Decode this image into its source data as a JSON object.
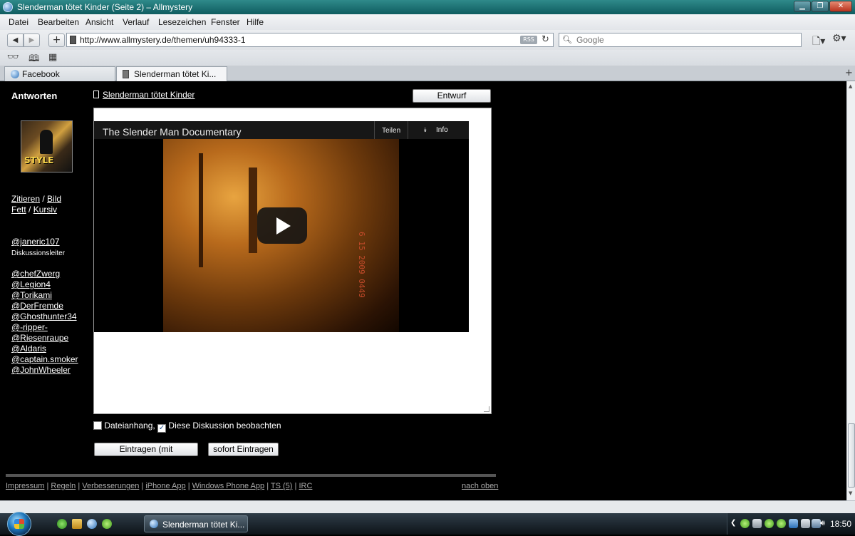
{
  "window": {
    "title": "Slenderman tötet Kinder (Seite 2) – Allmystery"
  },
  "menu": [
    "Datei",
    "Bearbeiten",
    "Ansicht",
    "Verlauf",
    "Lesezeichen",
    "Fenster",
    "Hilfe"
  ],
  "navbar": {
    "url": "http://www.allmystery.de/themen/uh94333-1",
    "rss_label": "RSS",
    "search_placeholder": "Google"
  },
  "tabs": [
    {
      "label": "Facebook",
      "active": false
    },
    {
      "label": "Slenderman tötet Ki...",
      "active": true
    }
  ],
  "sidebar": {
    "heading": "Antworten",
    "avatar_text": "STYLE",
    "format_links": {
      "quote": "Zitieren",
      "image": "Bild",
      "bold": "Fett",
      "italic": "Kursiv",
      "separator": "/"
    },
    "leader": {
      "name": "@janeric107",
      "role": "Diskussionsleiter"
    },
    "participants": [
      "@chefZwerg",
      "@Legion4",
      "@Torikami",
      "@DerFremde",
      "@Ghosthunter34",
      "@-ripper-",
      "@Riesenraupe",
      "@Aldaris",
      "@captain.smoker",
      "@JohnWheeler"
    ]
  },
  "main": {
    "thread_title": "Slenderman tötet Kinder",
    "save_draft": "Entwurf speichern",
    "video": {
      "title": "The Slender Man Documentary",
      "share_label": "Teilen",
      "info_label": "Info",
      "timestamp": "6 15 2009 0449"
    },
    "attachment_label": "Dateianhang,",
    "attachment_checked": false,
    "watch_label": "Diese Diskussion beobachten",
    "watch_checked": true,
    "submit_preview": "Eintragen (mit Vorschau)",
    "submit_now": "sofort Eintragen"
  },
  "footer": {
    "links": [
      "Impressum",
      "Regeln",
      "Verbesserungen",
      "iPhone App",
      "Windows Phone App",
      "TS (5)",
      "IRC"
    ],
    "separator": "|",
    "back_to_top": "nach oben"
  },
  "taskbar": {
    "window_button": "Slenderman tötet Ki...",
    "clock": "18:50"
  }
}
